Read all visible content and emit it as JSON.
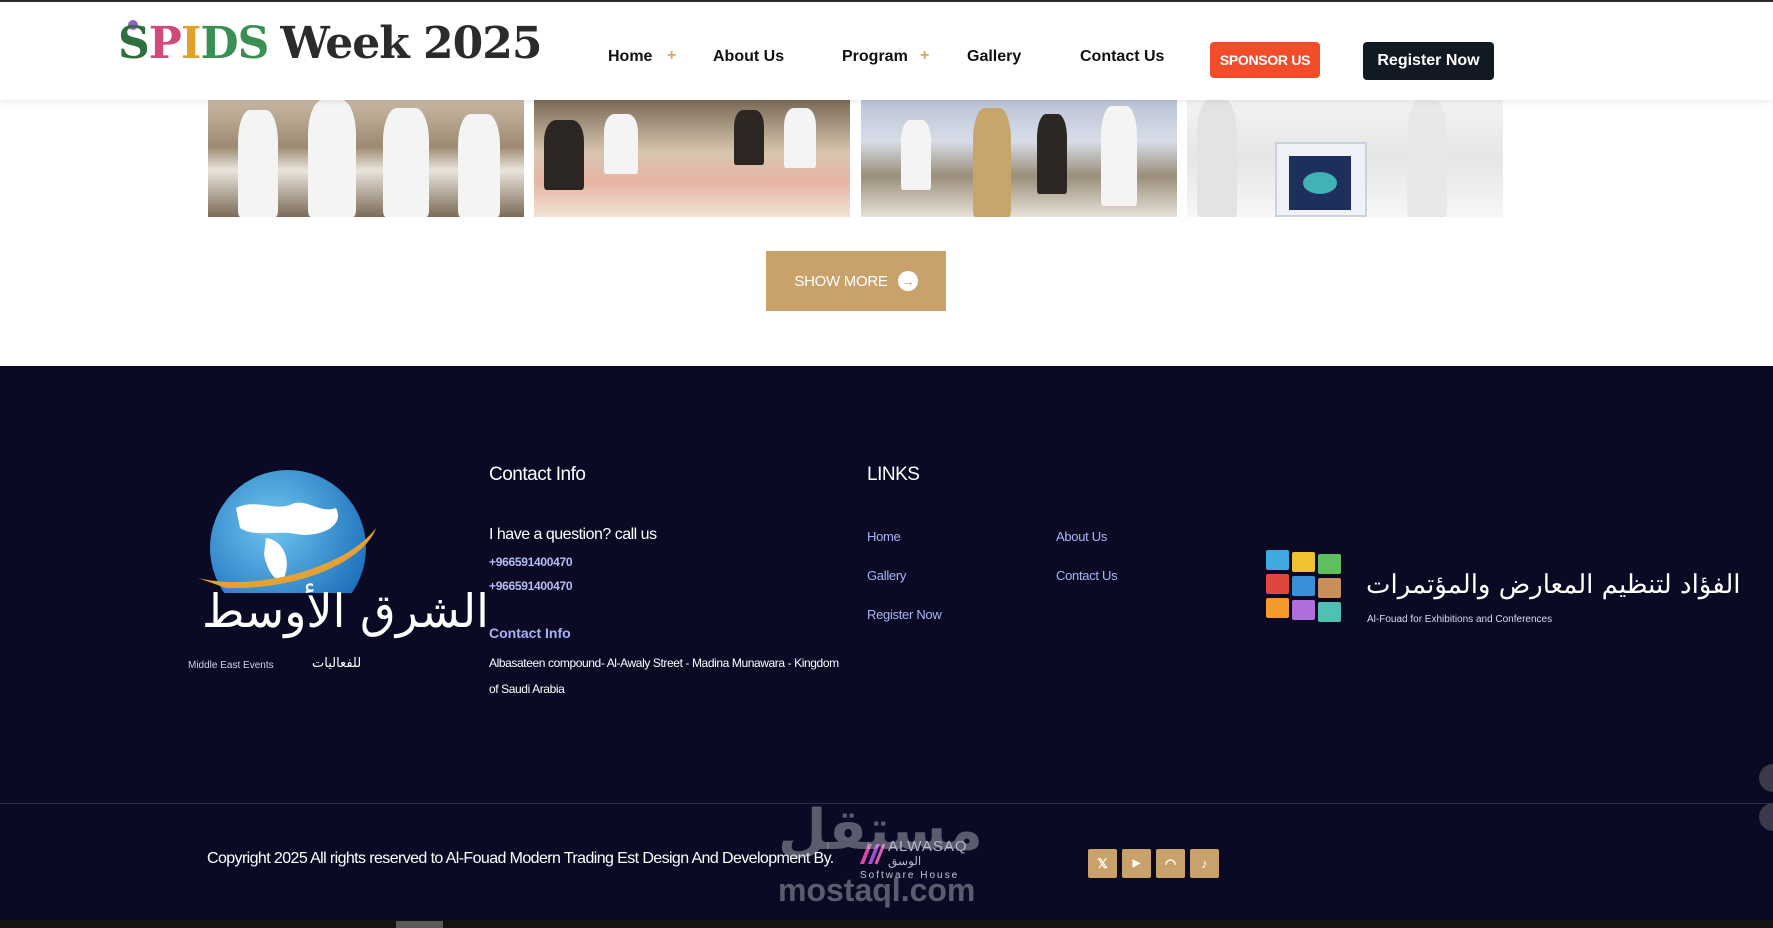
{
  "header": {
    "logo": {
      "s": "S",
      "p": "P",
      "i": "I",
      "ds": "DS",
      "rest": "Week 2025"
    },
    "nav": [
      {
        "label": "Home",
        "has_plus": true
      },
      {
        "label": "About Us",
        "has_plus": false
      },
      {
        "label": "Program",
        "has_plus": true
      },
      {
        "label": "Gallery",
        "has_plus": false
      },
      {
        "label": "Contact Us",
        "has_plus": false
      }
    ],
    "plus_symbol": "+",
    "sponsor_label": "SPONSOR US",
    "register_label": "Register Now"
  },
  "gallery": {
    "show_more_label": "SHOW MORE",
    "show_more_icon": "arrow-right-circle-icon"
  },
  "footer": {
    "brand": {
      "arabic": "الشرق الأوسط",
      "caption_en": "Middle East Events",
      "caption_ar": "للفعاليات"
    },
    "contact": {
      "heading": "Contact Info",
      "question": "I have a question? call us",
      "phones": [
        "+966591400470",
        "+966591400470"
      ],
      "sub_heading": "Contact Info",
      "address": "Albasateen compound- Al-Awaly Street - Madina Munawara - Kingdom of Saudi Arabia"
    },
    "links": {
      "heading": "LINKS",
      "col1": [
        "Home",
        "Gallery",
        "Register Now"
      ],
      "col2": [
        "About Us",
        "Contact Us"
      ]
    },
    "partner": {
      "arabic": "الفؤاد لتنظيم المعارض والمؤتمرات",
      "english": "Al-Fouad for Exhibitions and Conferences"
    },
    "copyright": "Copyright 2025 All rights reserved to Al-Fouad Modern Trading Est Design And Development By.",
    "developer": {
      "name": "ALWASAQ",
      "arabic": "الوسق",
      "tagline": "Software House"
    },
    "social": [
      {
        "icon": "x-twitter-icon",
        "glyph": "𝕏"
      },
      {
        "icon": "youtube-icon",
        "glyph": "▶"
      },
      {
        "icon": "snapchat-icon",
        "glyph": "◠"
      },
      {
        "icon": "tiktok-icon",
        "glyph": "♪"
      }
    ]
  },
  "watermark": {
    "arabic": "مستقل",
    "english": "mostaql.com"
  },
  "colors": {
    "gold": "#c9a26b",
    "sponsor": "#f14d2b",
    "register": "#111a22",
    "footer_bg": "#0b0a25",
    "link": "#a9b4f7"
  }
}
